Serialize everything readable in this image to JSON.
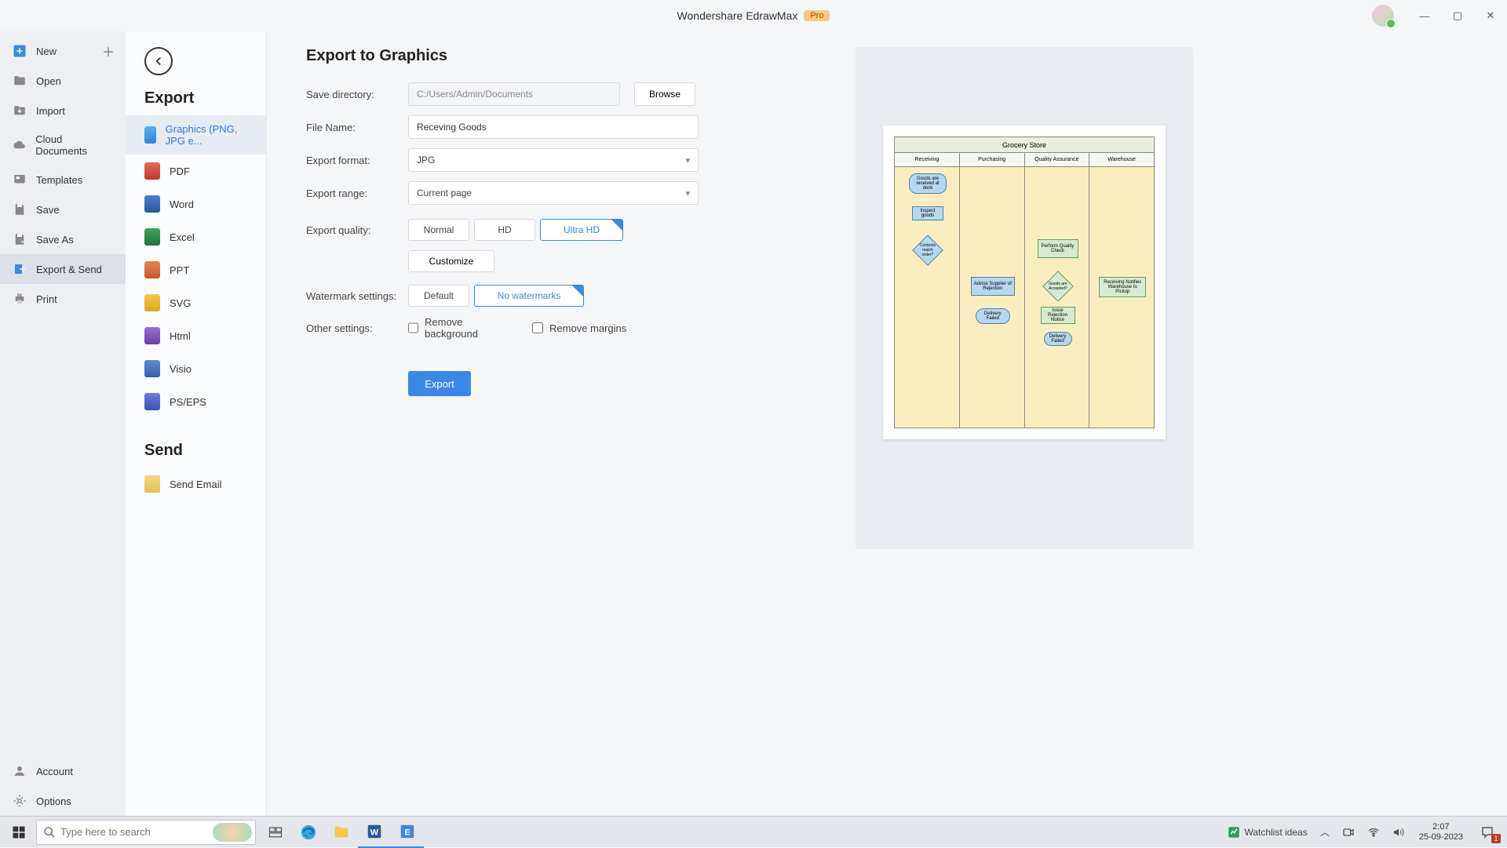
{
  "app": {
    "title": "Wondershare EdrawMax",
    "badge": "Pro"
  },
  "leftnav": {
    "new": "New",
    "open": "Open",
    "import": "Import",
    "cloud": "Cloud Documents",
    "templates": "Templates",
    "save": "Save",
    "saveas": "Save As",
    "exportsend": "Export & Send",
    "print": "Print",
    "account": "Account",
    "options": "Options"
  },
  "subpanel": {
    "export_title": "Export",
    "send_title": "Send",
    "items": {
      "graphics": "Graphics (PNG, JPG e...",
      "pdf": "PDF",
      "word": "Word",
      "excel": "Excel",
      "ppt": "PPT",
      "svg": "SVG",
      "html": "Html",
      "visio": "Visio",
      "pseps": "PS/EPS"
    },
    "send_email": "Send Email"
  },
  "form": {
    "heading": "Export to Graphics",
    "labels": {
      "dir": "Save directory:",
      "fname": "File Name:",
      "format": "Export format:",
      "range": "Export range:",
      "quality": "Export quality:",
      "watermark": "Watermark settings:",
      "other": "Other settings:"
    },
    "dir": "C:/Users/Admin/Documents",
    "fname": "Receving Goods",
    "browse": "Browse",
    "format": "JPG",
    "range": "Current page",
    "quality": {
      "normal": "Normal",
      "hd": "HD",
      "uhd": "Ultra HD"
    },
    "customize": "Customize",
    "watermark": {
      "default": "Default",
      "none": "No watermarks"
    },
    "other": {
      "bg": "Remove background",
      "margins": "Remove margins"
    },
    "export_btn": "Export"
  },
  "preview": {
    "title": "Grocery Store",
    "lanes": [
      "Receiving",
      "Purchasing",
      "Quality Assurance",
      "Warehouse"
    ]
  },
  "taskbar": {
    "search_ph": "Type here to search",
    "watchlist": "Watchlist ideas",
    "time": "2:07",
    "date": "25-09-2023",
    "notif_count": "1"
  }
}
